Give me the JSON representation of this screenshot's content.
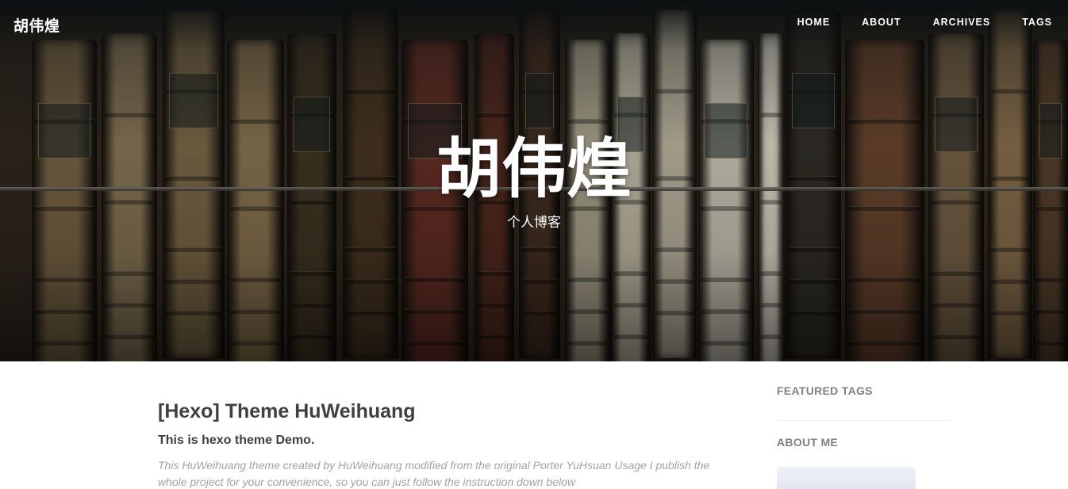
{
  "brand": "胡伟煌",
  "nav": {
    "items": [
      "HOME",
      "ABOUT",
      "ARCHIVES",
      "TAGS"
    ]
  },
  "hero": {
    "title": "胡伟煌",
    "subtitle": "个人博客"
  },
  "post": {
    "title": "[Hexo] Theme HuWeihuang",
    "subtitle": "This is hexo theme Demo.",
    "excerpt": "This HuWeihuang theme created by HuWeihuang modified from the original Porter YuHsuan Usage I publish the whole project for your convenience, so you can just follow the instruction down below"
  },
  "sidebar": {
    "featured_tags": "FEATURED TAGS",
    "about_me": "ABOUT ME"
  },
  "colors": {
    "text": "#404040",
    "muted": "#a3a3a3",
    "sidebar_heading": "#808080"
  }
}
